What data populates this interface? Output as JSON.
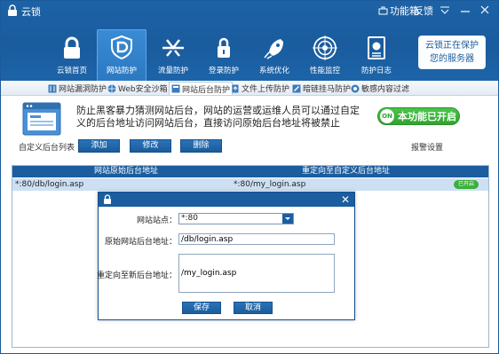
{
  "window": {
    "app_title": "云锁",
    "feature_button": "功能箱",
    "feedback_button": "反馈"
  },
  "nav": [
    {
      "label": "云锁首页",
      "icon": "lock-icon"
    },
    {
      "label": "网站防护",
      "icon": "shield-icon"
    },
    {
      "label": "流量防护",
      "icon": "traffic-icon"
    },
    {
      "label": "登录防护",
      "icon": "padlock-icon"
    },
    {
      "label": "系统优化",
      "icon": "rocket-icon"
    },
    {
      "label": "性能监控",
      "icon": "radar-icon"
    },
    {
      "label": "防护日志",
      "icon": "log-icon"
    }
  ],
  "promo": {
    "line1": "云锁正在保护",
    "line2": "您的服务器"
  },
  "subtabs": [
    {
      "label": "网站漏洞防护"
    },
    {
      "label": "Web安全沙箱"
    },
    {
      "label": "网站后台防护"
    },
    {
      "label": "文件上传防护"
    },
    {
      "label": "暗链挂马防护"
    },
    {
      "label": "敏感内容过滤"
    }
  ],
  "description": "防止黑客暴力猜测网站后台，网站的运营或运维人员可以通过自定义的后台地址访问网站后台，直接访问原始后台地址将被禁止",
  "toggle": {
    "knob": "ON",
    "label": "本功能已开启"
  },
  "toolbar": {
    "list_label": "自定义后台列表",
    "add": "添加",
    "edit": "修改",
    "delete": "删除",
    "report": "报警设置"
  },
  "table": {
    "headers": [
      "网站原始后台地址",
      "重定向至自定义后台地址"
    ],
    "rows": [
      {
        "original": "*:80/db/login.asp",
        "redirect": "*:80/my_login.asp",
        "status": "已开启"
      }
    ]
  },
  "dialog": {
    "site_label": "网站站点：",
    "site_value": "*:80",
    "original_label": "原始网站后台地址：",
    "original_value": "/db/login.asp",
    "redirect_label": "重定向至新后台地址：",
    "redirect_value": "/my_login.asp",
    "save": "保存",
    "cancel": "取消"
  },
  "colors": {
    "header_blue": "#1b5d9e",
    "accent_green": "#2ea52e",
    "row_selected": "#cde0f3"
  }
}
